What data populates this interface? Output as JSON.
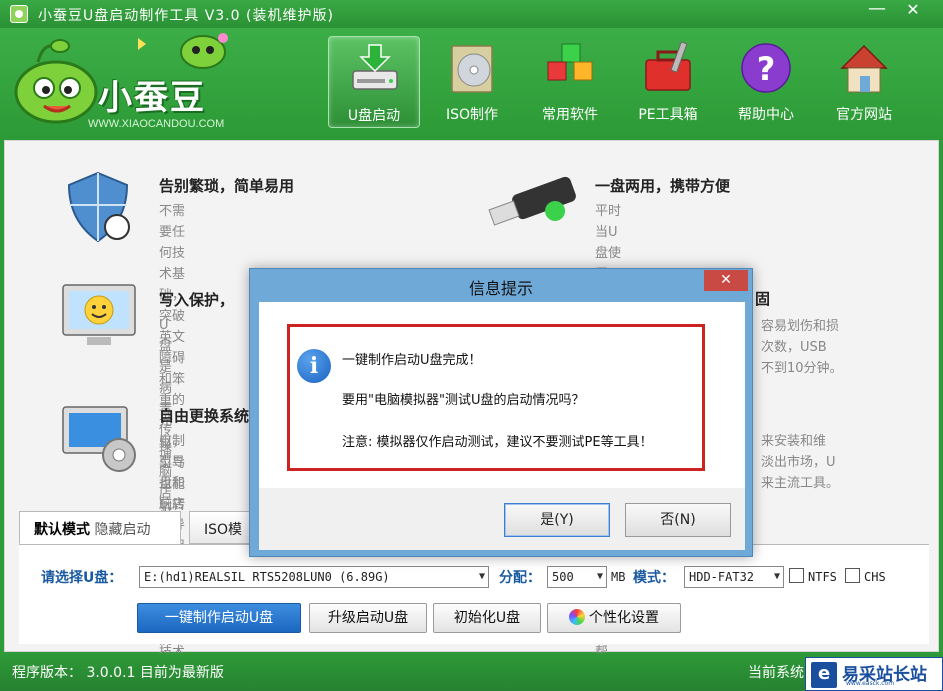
{
  "window": {
    "title": "小蚕豆U盘启动制作工具 V3.0 (装机维护版)",
    "minimize": "—",
    "close": "✕"
  },
  "logo": {
    "brand": "小蚕豆",
    "site": "WWW.XIAOCANDOU.COM"
  },
  "nav": {
    "items": [
      {
        "label": "U盘启动",
        "icon": "usb-drive-icon",
        "active": true
      },
      {
        "label": "ISO制作",
        "icon": "iso-disc-icon",
        "active": false
      },
      {
        "label": "常用软件",
        "icon": "software-cubes-icon",
        "active": false
      },
      {
        "label": "PE工具箱",
        "icon": "toolbox-icon",
        "active": false
      },
      {
        "label": "帮助中心",
        "icon": "help-icon",
        "active": false
      },
      {
        "label": "官方网站",
        "icon": "home-icon",
        "active": false
      }
    ]
  },
  "features": {
    "f1": {
      "title": "告别繁琐，简单易用",
      "desc": "不需要任何技术基础，突破英文障碍\n和笨重的光驱，菜鸟也能玩转电脑，\n实现全民普及电脑技术",
      "icon": "shield-icon"
    },
    "f2": {
      "title": "一盘两用，携带方便",
      "desc": "平时当U盘使用，需要的时候就是修\n复盘，完全不需要光驱和光盘，携带\n方便，最给力的帮手！",
      "icon": "usb-stick-icon"
    },
    "f3": {
      "title": "写入保护，",
      "desc": "U盘是病毒传播\n脑店引导盘采\n切断病毒传播",
      "icon": "monitor-smiley-icon"
    },
    "f3r": {
      "title": "固",
      "desc": "容易划伤和损\n次数，USB\n不到10分钟。"
    },
    "f4": {
      "title": "自由更换系统",
      "desc": "自制引导盘和\n脑店引导盘用\n方便快捷，一",
      "icon": "monitor-gear-icon"
    },
    "f4r": {
      "desc": "来安装和维\n淡出市场，U\n来主流工具。"
    }
  },
  "tabs": {
    "default_strong": "默认模式",
    "default_weak": "隐藏启动",
    "iso": "ISO模"
  },
  "controls": {
    "select_label": "请选择U盘：",
    "disk": "E:(hd1)REALSIL RTS5208LUN0 (6.89G)",
    "partition_label": "分配：",
    "partition": "500",
    "unit": "MB",
    "mode_label": "模式：",
    "mode": "HDD-FAT32",
    "ntfs": "NTFS",
    "chs": "CHS",
    "btn_make": "一键制作启动U盘",
    "btn_upgrade": "升级启动U盘",
    "btn_init": "初始化U盘",
    "btn_custom": "个性化设置"
  },
  "status": {
    "version": "程序版本： 3.0.0.1   目前为最新版",
    "right": "当前系统"
  },
  "watermark": {
    "text": "易采站长站",
    "sub": "www.easck.com"
  },
  "dialog": {
    "title": "信息提示",
    "close": "✕",
    "icon": "info-icon",
    "line1": "一键制作启动U盘完成！",
    "line2": "要用\"电脑模拟器\"测试U盘的启动情况吗？",
    "line3": "注意: 模拟器仅作启动测试，建议不要测试PE等工具！",
    "yes": "是(Y)",
    "no": "否(N)"
  },
  "colors": {
    "brand_green": "#2f9a3a",
    "dialog_frame": "#6fa9d8",
    "highlight_red": "#cc2222",
    "primary_blue": "#1c68c1"
  }
}
